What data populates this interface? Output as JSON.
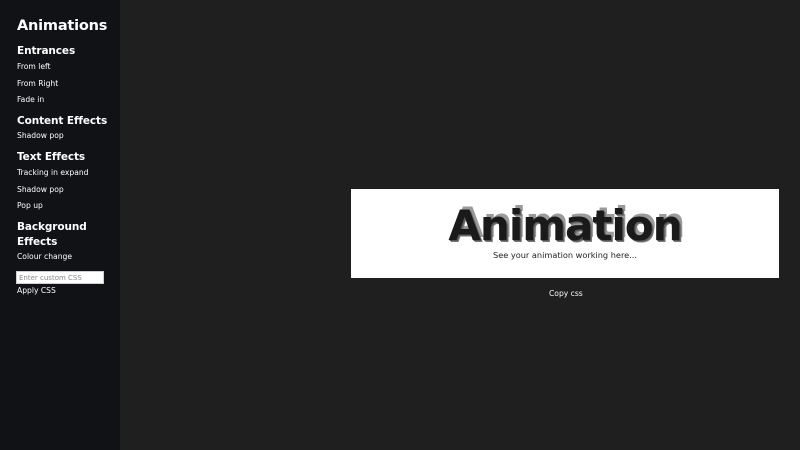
{
  "sidebar": {
    "title": "Animations",
    "sections": [
      {
        "title": "Entrances",
        "items": [
          "From left",
          "From Right",
          "Fade in"
        ]
      },
      {
        "title": "Content Effects",
        "items": [
          "Shadow pop"
        ]
      },
      {
        "title": "Text Effects",
        "items": [
          "Tracking in expand",
          "Shadow pop",
          "Pop up"
        ]
      },
      {
        "title_line1": "Background",
        "title_line2": "Effects",
        "items": [
          "Colour change"
        ]
      }
    ],
    "custom_css": {
      "placeholder": "Enter custom CSS",
      "value": ""
    },
    "apply_label": "Apply CSS"
  },
  "preview": {
    "word": "Animation",
    "caption": "See your animation working here...",
    "copy_label": "Copy css"
  },
  "colors": {
    "background": "#1f1f1f",
    "sidebar": "#111216",
    "preview_box": "#ffffff",
    "text": "#ffffff"
  }
}
